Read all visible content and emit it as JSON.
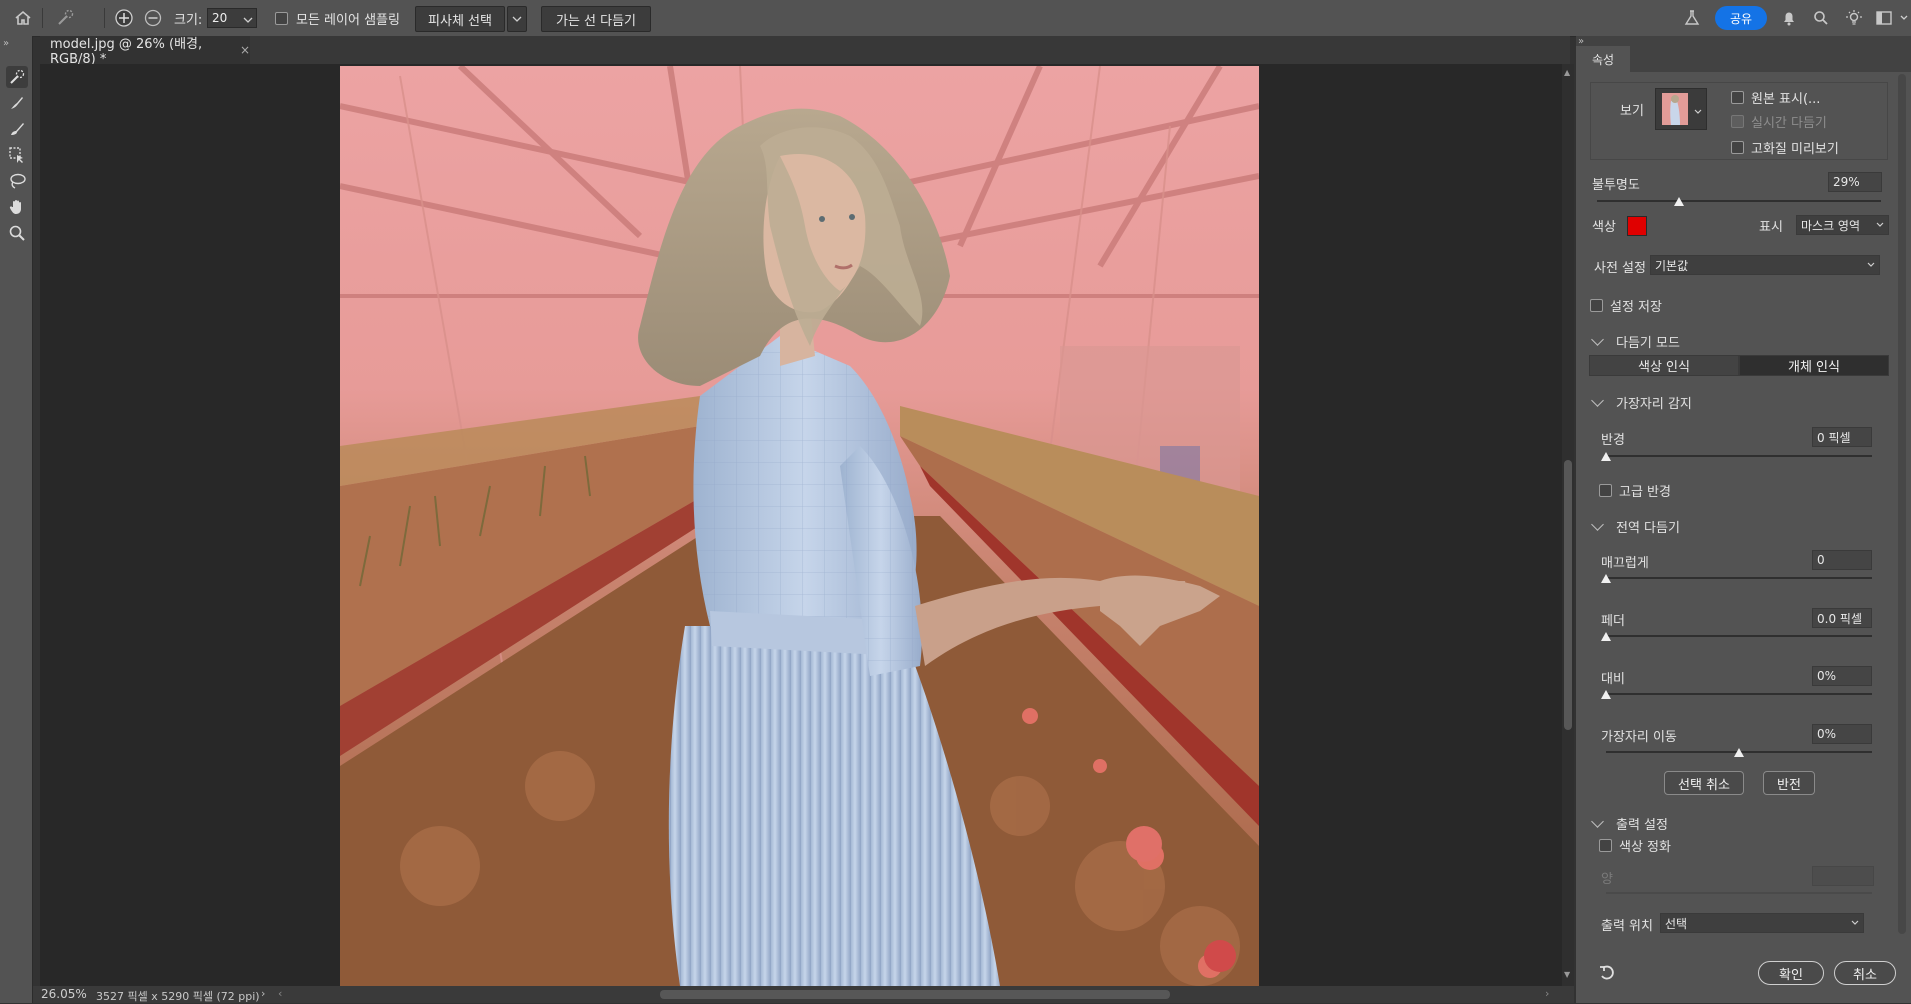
{
  "top_bar": {
    "size_label": "크기:",
    "size_value": "20",
    "sample_all_layers": "모든 레이어 샘플링",
    "select_subject": "피사체 선택",
    "refine_hair": "가는 선 다듬기",
    "share": "공유"
  },
  "document": {
    "tab_title": "model.jpg @ 26% (배경, RGB/8) *",
    "zoom": "26.05%",
    "dimensions": "3527 픽셀 x 5290 픽셀 (72 ppi)"
  },
  "panel": {
    "tab": "속성",
    "view_label": "보기",
    "show_original": "원본 표시(...",
    "realtime_refine": "실시간 다듬기",
    "hq_preview": "고화질 미리보기",
    "opacity_label": "불투명도",
    "opacity_value": "29%",
    "opacity_level": 0.29,
    "color_label": "색상",
    "color_value": "#e00000",
    "display_label": "표시",
    "display_value": "마스크 영역",
    "preset_label": "사전 설정",
    "preset_value": "기본값",
    "save_settings": "설정 저장",
    "refine_mode_title": "다듬기 모드",
    "mode_color": "색상 인식",
    "mode_object": "개체 인식",
    "edge_detection_title": "가장자리 감지",
    "radius_label": "반경",
    "radius_value": "0 픽셀",
    "smart_radius": "고급 반경",
    "global_refine_title": "전역 다듬기",
    "smooth_label": "매끄럽게",
    "smooth_value": "0",
    "feather_label": "페더",
    "feather_value": "0.0 픽셀",
    "contrast_label": "대비",
    "contrast_value": "0%",
    "shift_edge_label": "가장자리 이동",
    "shift_edge_value": "0%",
    "shift_edge_level": 0.5,
    "clear_selection": "선택 취소",
    "invert": "반전",
    "output_title": "출력 설정",
    "decontaminate": "색상 정화",
    "amount_label": "양",
    "output_to_label": "출력 위치",
    "output_to_value": "선택",
    "ok": "확인",
    "cancel": "취소"
  },
  "colors": {
    "accent": "#1473e6",
    "overlay_color": "#e00000",
    "panel_bg": "#535353"
  }
}
